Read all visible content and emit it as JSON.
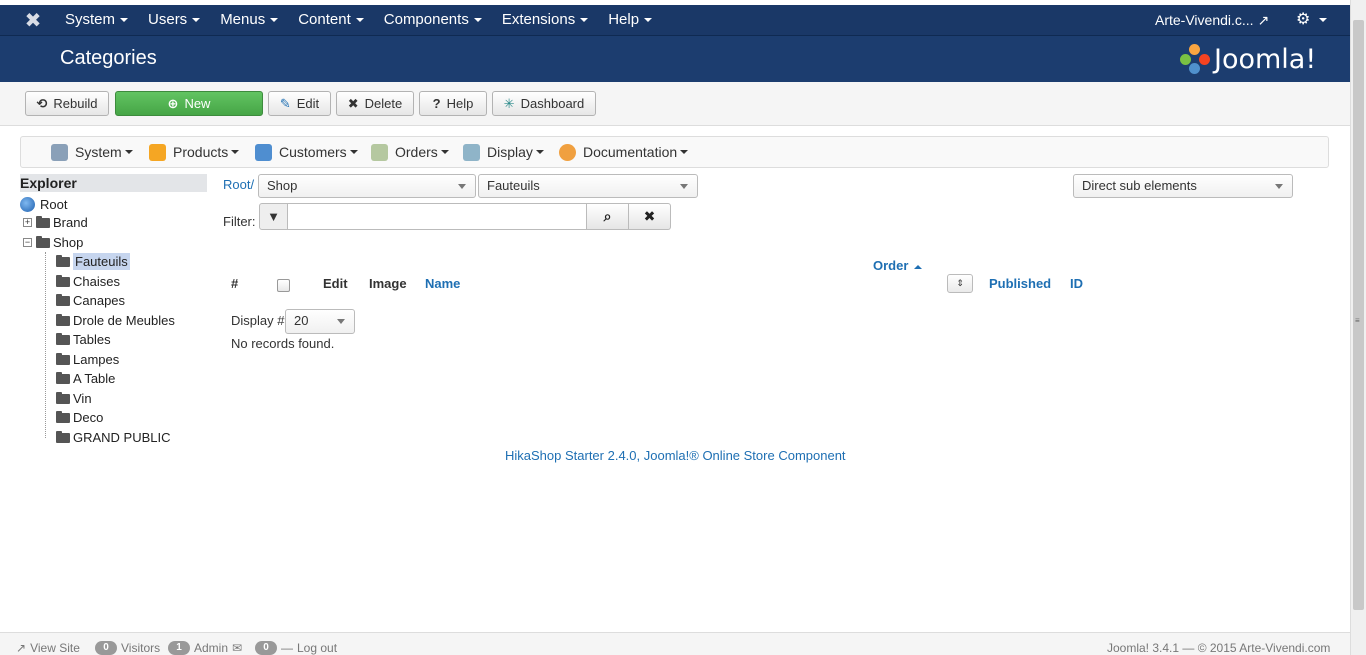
{
  "topnav": {
    "items": [
      "System",
      "Users",
      "Menus",
      "Content",
      "Components",
      "Extensions",
      "Help"
    ],
    "site_name": "Arte-Vivendi.c...",
    "gear_icon": "gear-icon"
  },
  "titlebar": {
    "title": "Categories",
    "brand": "Joomla!",
    "brand_colors": [
      "#f9a541",
      "#f44321",
      "#5091cd",
      "#7ac143"
    ]
  },
  "toolbar": {
    "rebuild": "Rebuild",
    "new": "New",
    "edit": "Edit",
    "delete": "Delete",
    "help": "Help",
    "dashboard": "Dashboard"
  },
  "submenu": {
    "items": [
      "System",
      "Products",
      "Customers",
      "Orders",
      "Display",
      "Documentation"
    ]
  },
  "explorer": {
    "heading": "Explorer",
    "root": "Root",
    "brand": "Brand",
    "shop": "Shop",
    "children": [
      "Fauteuils",
      "Chaises",
      "Canapes",
      "Drole de Meubles",
      "Tables",
      "Lampes",
      "A Table",
      "Vin",
      "Deco",
      "GRAND PUBLIC"
    ],
    "selected": "Fauteuils"
  },
  "main": {
    "crumb": "Root/",
    "select_parent": "Shop",
    "select_child": "Fauteuils",
    "select_scope": "Direct sub elements",
    "filter_label": "Filter:",
    "filter_value": "",
    "columns": {
      "num": "#",
      "edit": "Edit",
      "image": "Image",
      "name": "Name",
      "order": "Order",
      "published": "Published",
      "id": "ID"
    },
    "display_label": "Display #",
    "display_value": "20",
    "no_records": "No records found.",
    "footer": "HikaShop Starter 2.4.0, Joomla!® Online Store Component"
  },
  "statusbar": {
    "view_site": "View Site",
    "visitors_count": "0",
    "visitors": "Visitors",
    "admin_count": "1",
    "admin": "Admin",
    "messages_count": "0",
    "logout": "Log out",
    "copyright": "Joomla! 3.4.1 — © 2015 Arte-Vivendi.com"
  }
}
